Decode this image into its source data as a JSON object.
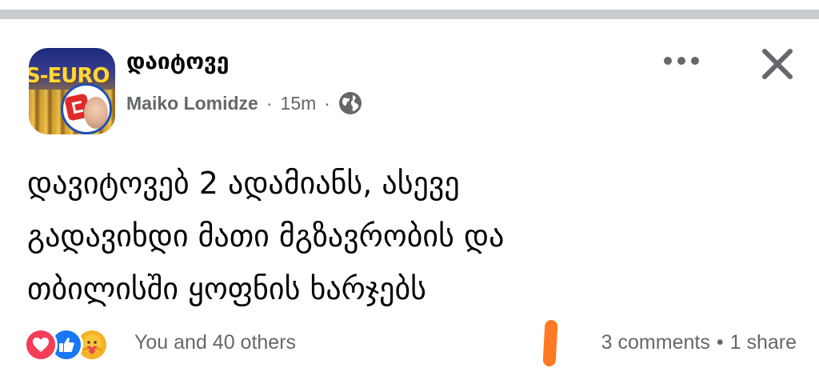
{
  "post": {
    "page_name": "დაიტოვე",
    "avatar_text": "S-EURO",
    "author": "Maiko Lomidze",
    "time": "15m",
    "separator": "·",
    "audience_icon": "globe-icon",
    "text_lines": [
      "დავიტოვებ 2 ადამიანს, ასევე",
      "გადავიხდი მათი მგზავრობის და",
      "თბილისში ყოფნის ხარჯებს"
    ]
  },
  "actions": {
    "more_icon": "more-options-icon",
    "close_icon": "close-icon"
  },
  "reactions": {
    "icons": [
      "love-reaction-icon",
      "like-reaction-icon",
      "care-reaction-icon"
    ],
    "summary": "You and 40 others",
    "comments": "3 comments",
    "dot": "•",
    "shares": "1 share"
  },
  "colors": {
    "text": "#050505",
    "secondary": "#65676b",
    "like": "#1877f2",
    "love": "#f33e58",
    "care": "#f7b125",
    "divider": "#c9ccd1",
    "stylus_mark": "#ff7a22"
  }
}
